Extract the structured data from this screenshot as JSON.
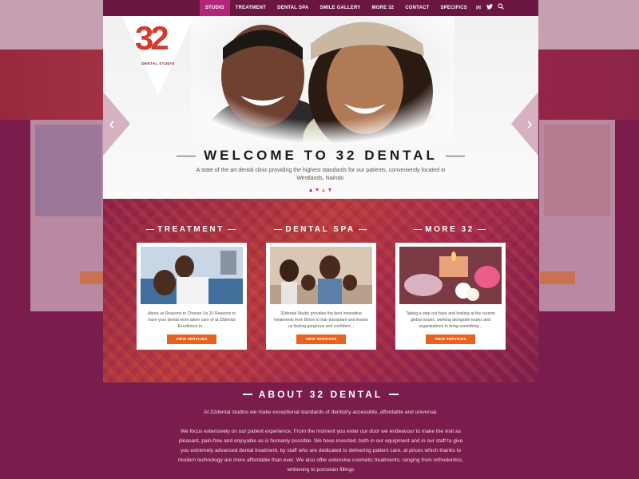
{
  "nav": {
    "items": [
      "STUDIO",
      "TREATMENT",
      "DENTAL SPA",
      "SMILE GALLERY",
      "MORE 32",
      "CONTACT",
      "SPECIFICS"
    ],
    "icons": [
      "mail-icon",
      "twitter-icon",
      "search-icon"
    ]
  },
  "logo": {
    "number": "32",
    "text": "DENTAL STUDIO"
  },
  "hero": {
    "title": "WELCOME TO 32 DENTAL",
    "subtitle": "A state of the art dental clinic providing the highest standards for our patients, conveniently located in Westlands, Nairobi.",
    "prev": "‹",
    "next": "›"
  },
  "services": [
    {
      "title": "TREATMENT",
      "text": "About us Reasons to Choose Us 10 Reasons to have your dental work taken care of at 32dental Excellence in...",
      "button": "VIEW SERVICES"
    },
    {
      "title": "DENTAL SPA",
      "text": "32dental Studio provides the best innovative treatments from Botox to hair transplant and leaves us feeling gorgeous and confident...",
      "button": "VIEW SERVICES"
    },
    {
      "title": "MORE 32",
      "text": "Taking a step out back and looking at the current global issues, working alongside teams and organisations to bring something...",
      "button": "VIEW SERVICES"
    }
  ],
  "about": {
    "title": "ABOUT 32 DENTAL",
    "p1": "At 32dental studios we make exceptional standards of dentistry accessible, affordable and universal.",
    "p2": "We focus extensively on our patient experience. From the moment you enter our door we endeavour to make the visit as pleasant, pain-free and enjoyable as is humanly possible. We have invested, both in our equipment and in our staff to give you extremely advanced dental treatment, by staff who are dedicated to delivering patient care, at prices which thanks to modern technology are more affordable than ever. We also offer extensive cosmetic treatments; ranging from orthodontics, whitening to porcelain fillings"
  },
  "colors": {
    "brand": "#7b1d4c",
    "nav_active": "#b2267a",
    "button": "#e8631f"
  }
}
